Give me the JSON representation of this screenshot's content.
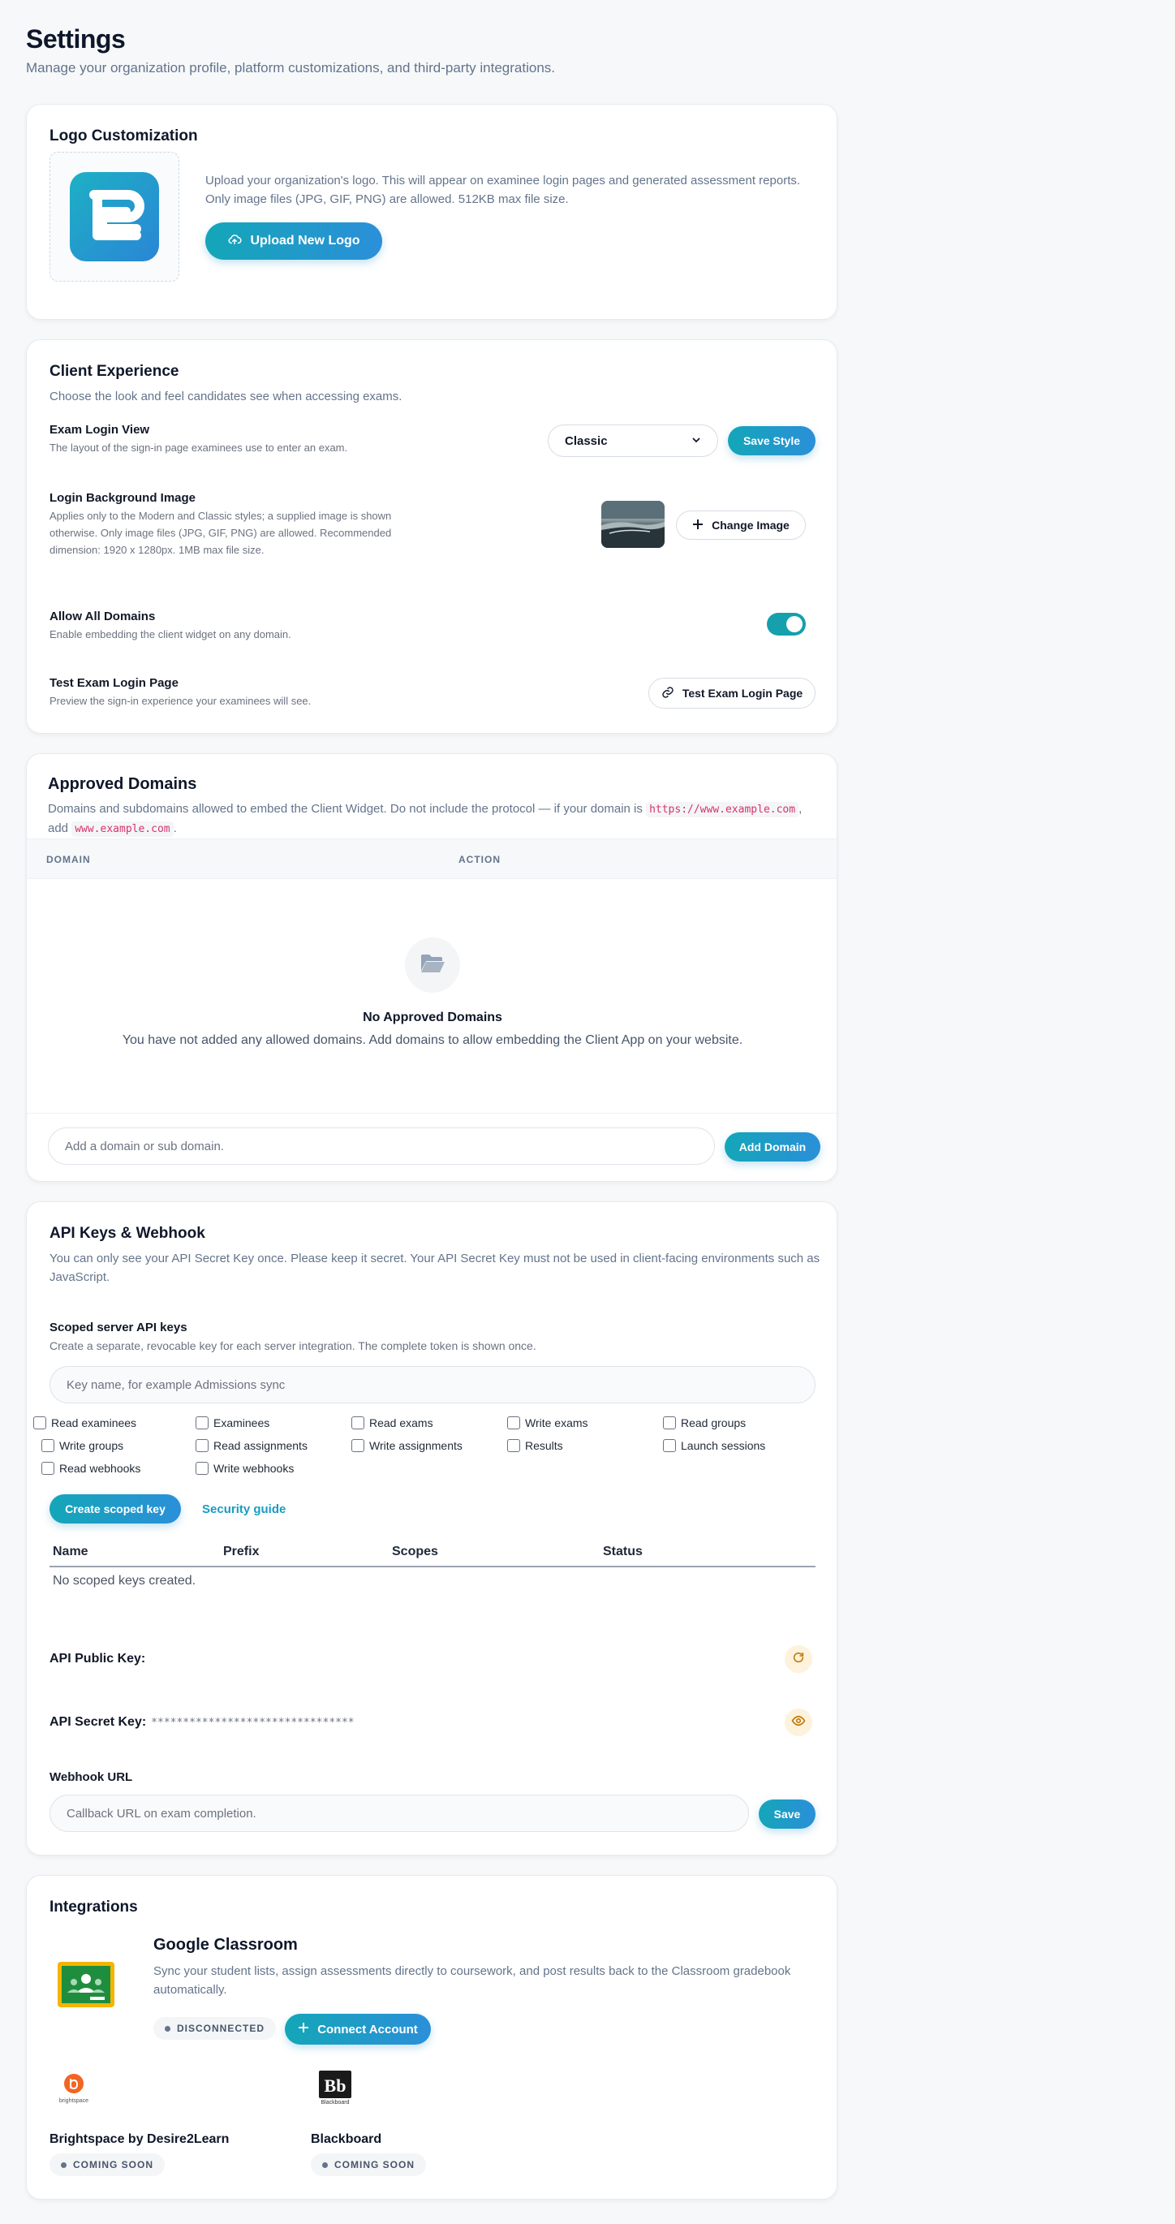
{
  "page": {
    "title": "Settings",
    "subtitle": "Manage your organization profile, platform customizations, and third-party integrations."
  },
  "logo_section": {
    "title": "Logo Customization",
    "description": "Upload your organization's logo. This will appear on examinee login pages and generated assessment reports. Only image files (JPG, GIF, PNG) are allowed. 512KB max file size.",
    "upload_label": "Upload New Logo",
    "icon": "cloud-upload-icon"
  },
  "client_experience": {
    "title": "Client Experience",
    "subtitle": "Choose the look and feel candidates see when accessing exams.",
    "login_view": {
      "label": "Exam Login View",
      "hint": "The layout of the sign-in page examinees use to enter an exam.",
      "selected": "Classic",
      "save_label": "Save Style"
    },
    "background": {
      "label": "Login Background Image",
      "hint": "Applies only to the Modern and Classic styles; a supplied image is shown otherwise. Only image files (JPG, GIF, PNG) are allowed. Recommended dimension: 1920 x 1280px. 1MB max file size.",
      "change_label": "Change Image"
    },
    "allow_domains": {
      "label": "Allow All Domains",
      "hint": "Enable embedding the client widget on any domain.",
      "enabled": true
    },
    "test_login": {
      "label": "Test Exam Login Page",
      "hint": "Preview the sign-in experience your examinees will see.",
      "button_label": "Test Exam Login Page"
    }
  },
  "approved_domains": {
    "title": "Approved Domains",
    "desc_part1": "Domains and subdomains allowed to embed the Client Widget. Do not include the protocol — if your domain is",
    "example_url": "https://www.example.com",
    "desc_part2": ",",
    "desc_part3": "add",
    "example_domain": "www.example.com",
    "desc_part4": ".",
    "columns": [
      "DOMAIN",
      "ACTION"
    ],
    "empty_title": "No Approved Domains",
    "empty_text": "You have not added any allowed domains. Add domains to allow embedding the Client App on your website.",
    "input_placeholder": "Add a domain or sub domain.",
    "add_label": "Add Domain"
  },
  "api": {
    "title": "API Keys & Webhook",
    "description": "You can only see your API Secret Key once. Please keep it secret. Your API Secret Key must not be used in client-facing environments such as JavaScript.",
    "scoped": {
      "label": "Scoped server API keys",
      "hint": "Create a separate, revocable key for each server integration. The complete token is shown once.",
      "name_placeholder": "Key name, for example Admissions sync",
      "scopes": [
        "Read examinees",
        "Examinees",
        "Read exams",
        "Write exams",
        "Read groups",
        "Write groups",
        "Read assignments",
        "Write assignments",
        "Results",
        "Launch sessions",
        "Read webhooks",
        "Write webhooks"
      ],
      "create_label": "Create scoped key",
      "guide_label": "Security guide",
      "table_columns": [
        "Name",
        "Prefix",
        "Scopes",
        "Status"
      ],
      "empty_text": "No scoped keys created."
    },
    "public_key_label": "API Public Key:",
    "secret_key_label": "API Secret Key:",
    "secret_key_value": "********************************",
    "webhook_label": "Webhook URL",
    "webhook_placeholder": "Callback URL on exam completion.",
    "webhook_save_label": "Save"
  },
  "integrations": {
    "title": "Integrations",
    "google": {
      "name": "Google Classroom",
      "description": "Sync your student lists, assign assessments directly to coursework, and post results back to the Classroom gradebook automatically.",
      "status": "DISCONNECTED",
      "connect_label": "Connect Account"
    },
    "brightspace": {
      "name": "Brightspace by Desire2Learn",
      "logo_text": "brightspace",
      "status": "COMING SOON"
    },
    "blackboard": {
      "name": "Blackboard",
      "logo_text": "Blackboard",
      "status": "COMING SOON"
    }
  },
  "colors": {
    "accent": "#14a6b8",
    "accent_blue": "#2b8fd9",
    "code_pink": "#d6336c"
  }
}
